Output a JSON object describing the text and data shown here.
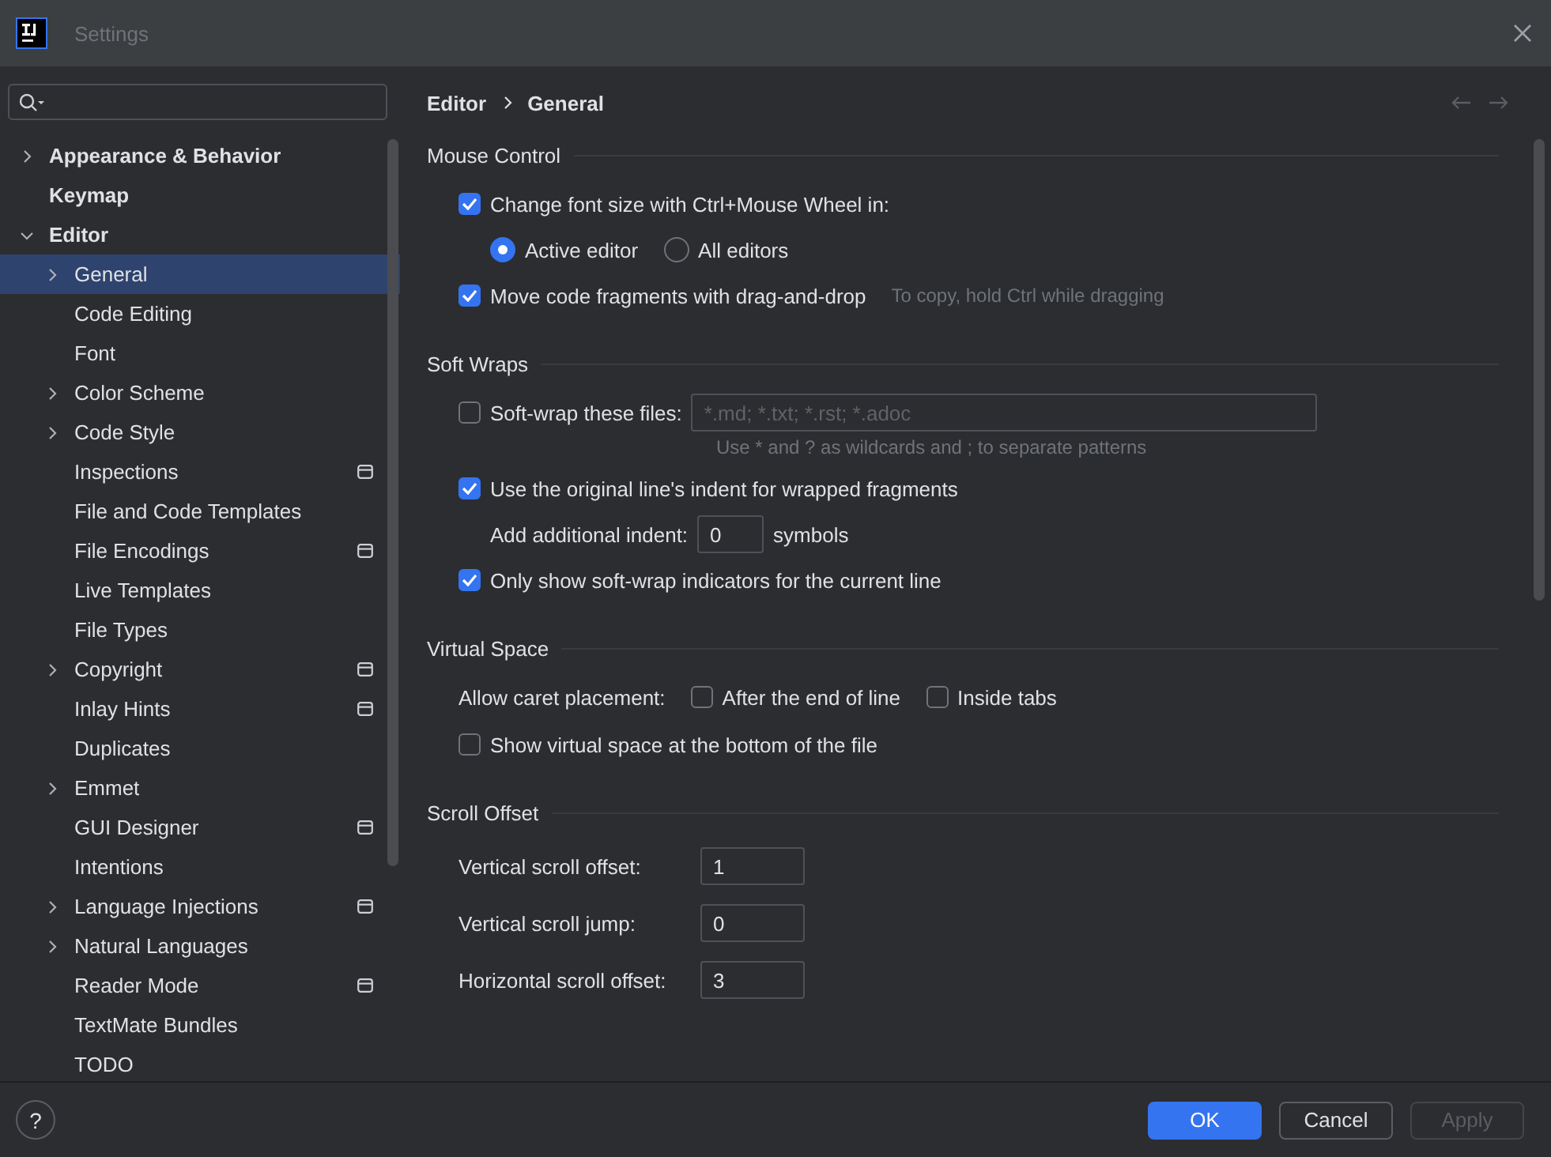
{
  "window": {
    "title": "Settings"
  },
  "sidebar": {
    "items": [
      {
        "label": "Appearance & Behavior",
        "kind": "collapsed",
        "selected": false,
        "project_scoped": false
      },
      {
        "label": "Keymap",
        "kind": "leaf",
        "selected": false,
        "project_scoped": false
      },
      {
        "label": "Editor",
        "kind": "expanded",
        "selected": false,
        "project_scoped": false,
        "children": [
          {
            "label": "General",
            "kind": "collapsed",
            "selected": true,
            "project_scoped": false
          },
          {
            "label": "Code Editing",
            "kind": "leaf",
            "selected": false,
            "project_scoped": false
          },
          {
            "label": "Font",
            "kind": "leaf",
            "selected": false,
            "project_scoped": false
          },
          {
            "label": "Color Scheme",
            "kind": "collapsed",
            "selected": false,
            "project_scoped": false
          },
          {
            "label": "Code Style",
            "kind": "collapsed",
            "selected": false,
            "project_scoped": false
          },
          {
            "label": "Inspections",
            "kind": "leaf",
            "selected": false,
            "project_scoped": true
          },
          {
            "label": "File and Code Templates",
            "kind": "leaf",
            "selected": false,
            "project_scoped": false
          },
          {
            "label": "File Encodings",
            "kind": "leaf",
            "selected": false,
            "project_scoped": true
          },
          {
            "label": "Live Templates",
            "kind": "leaf",
            "selected": false,
            "project_scoped": false
          },
          {
            "label": "File Types",
            "kind": "leaf",
            "selected": false,
            "project_scoped": false
          },
          {
            "label": "Copyright",
            "kind": "collapsed",
            "selected": false,
            "project_scoped": true
          },
          {
            "label": "Inlay Hints",
            "kind": "leaf",
            "selected": false,
            "project_scoped": true
          },
          {
            "label": "Duplicates",
            "kind": "leaf",
            "selected": false,
            "project_scoped": false
          },
          {
            "label": "Emmet",
            "kind": "collapsed",
            "selected": false,
            "project_scoped": false
          },
          {
            "label": "GUI Designer",
            "kind": "leaf",
            "selected": false,
            "project_scoped": true
          },
          {
            "label": "Intentions",
            "kind": "leaf",
            "selected": false,
            "project_scoped": false
          },
          {
            "label": "Language Injections",
            "kind": "collapsed",
            "selected": false,
            "project_scoped": true
          },
          {
            "label": "Natural Languages",
            "kind": "collapsed",
            "selected": false,
            "project_scoped": false
          },
          {
            "label": "Reader Mode",
            "kind": "leaf",
            "selected": false,
            "project_scoped": true
          },
          {
            "label": "TextMate Bundles",
            "kind": "leaf",
            "selected": false,
            "project_scoped": false
          },
          {
            "label": "TODO",
            "kind": "leaf",
            "selected": false,
            "project_scoped": false
          }
        ]
      }
    ]
  },
  "breadcrumb": [
    "Editor",
    "General"
  ],
  "sections": [
    {
      "title": "Mouse Control",
      "rows": [
        {
          "kind": "checkbox",
          "label": "Change font size with Ctrl+Mouse Wheel in:",
          "checked": true
        },
        {
          "kind": "radios",
          "options": [
            {
              "label": "Active editor",
              "selected": true
            },
            {
              "label": "All editors",
              "selected": false
            }
          ]
        },
        {
          "kind": "checkbox",
          "label": "Move code fragments with drag-and-drop",
          "checked": true,
          "hint": "To copy, hold Ctrl while dragging"
        }
      ]
    },
    {
      "title": "Soft Wraps",
      "rows": [
        {
          "kind": "checkbox_field",
          "label": "Soft-wrap these files:",
          "checked": false,
          "placeholder": "*.md; *.txt; *.rst; *.adoc",
          "note": "Use * and ? as wildcards and ; to separate patterns"
        },
        {
          "kind": "checkbox",
          "label": "Use the original line's indent for wrapped fragments",
          "checked": true
        },
        {
          "kind": "inline_number",
          "label": "Add additional indent:",
          "value": "0",
          "unit": "symbols"
        },
        {
          "kind": "checkbox",
          "label": "Only show soft-wrap indicators for the current line",
          "checked": true
        }
      ]
    },
    {
      "title": "Virtual Space",
      "rows": [
        {
          "kind": "checkbox_group",
          "label": "Allow caret placement:",
          "options": [
            {
              "label": "After the end of line",
              "checked": false
            },
            {
              "label": "Inside tabs",
              "checked": false
            }
          ]
        },
        {
          "kind": "checkbox",
          "label": "Show virtual space at the bottom of the file",
          "checked": false
        }
      ]
    },
    {
      "title": "Scroll Offset",
      "rows": [
        {
          "kind": "number",
          "label": "Vertical scroll offset:",
          "value": "1"
        },
        {
          "kind": "number",
          "label": "Vertical scroll jump:",
          "value": "0"
        },
        {
          "kind": "number",
          "label": "Horizontal scroll offset:",
          "value": "3"
        }
      ]
    }
  ],
  "footer": {
    "help": "?",
    "buttons": [
      {
        "label": "OK",
        "kind": "primary",
        "disabled": false
      },
      {
        "label": "Cancel",
        "kind": "normal",
        "disabled": false
      },
      {
        "label": "Apply",
        "kind": "normal",
        "disabled": true
      }
    ]
  }
}
